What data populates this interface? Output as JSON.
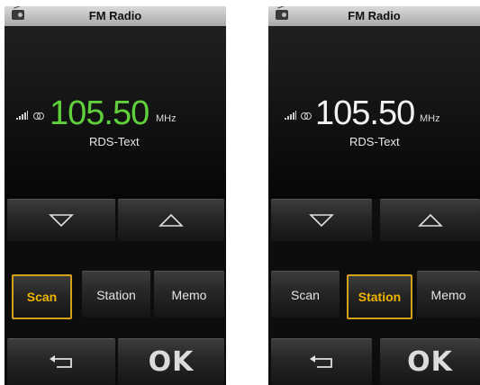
{
  "colors": {
    "title_bar": "#c4c4c4",
    "screen_bg": "#0d0d0d",
    "selected_border": "#d4a017",
    "freq_green": "#5fcf3b",
    "freq_white": "#f2f2f2"
  },
  "screens": [
    {
      "title": "FM Radio",
      "frequency": "105.50",
      "frequency_color": "#5fcf3b",
      "unit": "MHz",
      "rds_text": "RDS-Text",
      "icons": [
        "radio-icon",
        "signal-strength-icon",
        "stereo-icon",
        "arrow-down-icon",
        "arrow-up-icon",
        "back-icon"
      ],
      "buttons": {
        "scan": "Scan",
        "station": "Station",
        "memo": "Memo",
        "ok": "OK"
      },
      "selected_button": "Scan"
    },
    {
      "title": "FM Radio",
      "frequency": "105.50",
      "frequency_color": "#f2f2f2",
      "unit": "MHz",
      "rds_text": "RDS-Text",
      "icons": [
        "radio-icon",
        "signal-strength-icon",
        "stereo-icon",
        "arrow-down-icon",
        "arrow-up-icon",
        "back-icon"
      ],
      "buttons": {
        "scan": "Scan",
        "station": "Station",
        "memo": "Memo",
        "ok": "OK"
      },
      "selected_button": "Station"
    }
  ]
}
